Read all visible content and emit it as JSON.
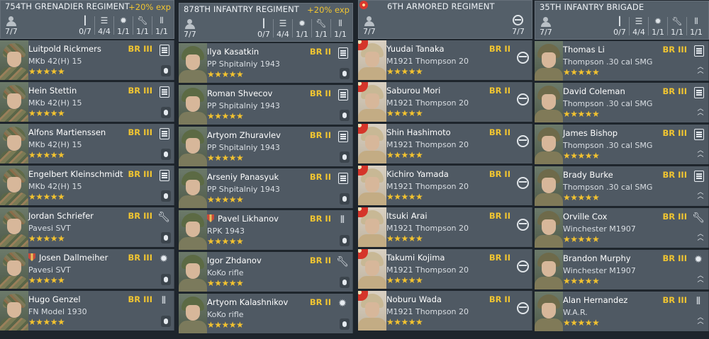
{
  "columns": [
    {
      "title": "754TH GRENADIER REGIMENT",
      "bonus": "+20% exp",
      "squad_count": "7/7",
      "stats": [
        {
          "icon": "rifle-icon",
          "value": "0/7"
        },
        {
          "icon": "assault-icon",
          "value": "4/4"
        },
        {
          "icon": "explosion-icon",
          "value": "1/1"
        },
        {
          "icon": "wrench-icon",
          "value": "1/1"
        },
        {
          "icon": "ammo-icon",
          "value": "1/1"
        }
      ],
      "soldiers": [
        {
          "name": "Luitpold Rickmers",
          "weapon": "MKb 42(H) 15",
          "br": "BR III",
          "stars": "★★★★★",
          "class_icon": "assault-icon",
          "rank_icon": "rank-icon"
        },
        {
          "name": "Hein Stettin",
          "weapon": "MKb 42(H) 15",
          "br": "BR III",
          "stars": "★★★★★",
          "class_icon": "assault-icon",
          "rank_icon": "rank-icon"
        },
        {
          "name": "Alfons Martienssen",
          "weapon": "MKb 42(H) 15",
          "br": "BR III",
          "stars": "★★★★★",
          "class_icon": "assault-icon",
          "rank_icon": "rank-icon"
        },
        {
          "name": "Engelbert Kleinschmidt",
          "weapon": "MKb 42(H) 15",
          "br": "BR III",
          "stars": "★★★★★",
          "class_icon": "assault-icon",
          "rank_icon": "rank-icon"
        },
        {
          "name": "Jordan Schriefer",
          "weapon": "Pavesi SVT",
          "br": "BR III",
          "stars": "★★★★★",
          "class_icon": "wrench-icon",
          "rank_icon": "rank-icon"
        },
        {
          "name": "Josen Dallmeiher",
          "weapon": "Pavesi SVT",
          "br": "BR III",
          "stars": "★★★★★",
          "class_icon": "explosion-icon",
          "rank_icon": "rank-icon",
          "medal": true
        },
        {
          "name": "Hugo Genzel",
          "weapon": "FN Model 1930",
          "br": "BR III",
          "stars": "★★★★★",
          "class_icon": "ammo-icon",
          "rank_icon": "rank-icon"
        }
      ]
    },
    {
      "title": "878TH INFANTRY REGIMENT",
      "bonus": "+20% exp",
      "squad_count": "7/7",
      "stats": [
        {
          "icon": "rifle-icon",
          "value": "0/7"
        },
        {
          "icon": "assault-icon",
          "value": "4/4"
        },
        {
          "icon": "explosion-icon",
          "value": "1/1"
        },
        {
          "icon": "wrench-icon",
          "value": "1/1"
        },
        {
          "icon": "ammo-icon",
          "value": "1/1"
        }
      ],
      "soldiers": [
        {
          "name": "Ilya Kasatkin",
          "weapon": "PP Shpitalniy 1943",
          "br": "BR II",
          "stars": "★★★★★",
          "class_icon": "assault-icon",
          "rank_icon": "rank-icon"
        },
        {
          "name": "Roman Shvecov",
          "weapon": "PP Shpitalniy 1943",
          "br": "BR II",
          "stars": "★★★★★",
          "class_icon": "assault-icon",
          "rank_icon": "rank-icon"
        },
        {
          "name": "Artyom Zhuravlev",
          "weapon": "PP Shpitalniy 1943",
          "br": "BR II",
          "stars": "★★★★★",
          "class_icon": "assault-icon",
          "rank_icon": "rank-icon"
        },
        {
          "name": "Arseniy Panasyuk",
          "weapon": "PP Shpitalniy 1943",
          "br": "BR II",
          "stars": "★★★★★",
          "class_icon": "assault-icon",
          "rank_icon": "rank-icon"
        },
        {
          "name": "Pavel Likhanov",
          "weapon": "RPK 1943",
          "br": "BR II",
          "stars": "★★★★★",
          "class_icon": "ammo-icon",
          "rank_icon": "rank-icon",
          "medal": true
        },
        {
          "name": "Igor Zhdanov",
          "weapon": "KoKo rifle",
          "br": "BR II",
          "stars": "★★★★★",
          "class_icon": "wrench-icon",
          "rank_icon": "rank-icon"
        },
        {
          "name": "Artyom Kalashnikov",
          "weapon": "KoKo rifle",
          "br": "BR II",
          "stars": "★★★★★",
          "class_icon": "explosion-icon",
          "rank_icon": "rank-icon"
        }
      ]
    },
    {
      "title": "6TH ARMORED REGIMENT",
      "squad_count": "7/7",
      "vehicle_count": "7/7",
      "soldiers": [
        {
          "name": "Yuudai Tanaka",
          "weapon": "M1921 Thompson 20",
          "br": "BR II",
          "stars": "★★★★★",
          "class_icon": "steering-wheel-icon"
        },
        {
          "name": "Saburou Mori",
          "weapon": "M1921 Thompson 20",
          "br": "BR II",
          "stars": "★★★★★",
          "class_icon": "steering-wheel-icon"
        },
        {
          "name": "Shin Hashimoto",
          "weapon": "M1921 Thompson 20",
          "br": "BR II",
          "stars": "★★★★★",
          "class_icon": "steering-wheel-icon"
        },
        {
          "name": "Kichiro Yamada",
          "weapon": "M1921 Thompson 20",
          "br": "BR II",
          "stars": "★★★★★",
          "class_icon": "steering-wheel-icon"
        },
        {
          "name": "Itsuki Arai",
          "weapon": "M1921 Thompson 20",
          "br": "BR II",
          "stars": "★★★★★",
          "class_icon": "steering-wheel-icon"
        },
        {
          "name": "Takumi Kojima",
          "weapon": "M1921 Thompson 20",
          "br": "BR II",
          "stars": "★★★★★",
          "class_icon": "steering-wheel-icon"
        },
        {
          "name": "Noburu Wada",
          "weapon": "M1921 Thompson 20",
          "br": "BR II",
          "stars": "★★★★★",
          "class_icon": "steering-wheel-icon"
        }
      ]
    },
    {
      "title": "35TH INFANTRY BRIGADE",
      "squad_count": "7/7",
      "stats": [
        {
          "icon": "rifle-icon",
          "value": "0/7"
        },
        {
          "icon": "assault-icon",
          "value": "4/4"
        },
        {
          "icon": "explosion-icon",
          "value": "1/1"
        },
        {
          "icon": "wrench-icon",
          "value": "1/1"
        },
        {
          "icon": "ammo-icon",
          "value": "1/1"
        }
      ],
      "soldiers": [
        {
          "name": "Thomas Li",
          "weapon": "Thompson .30 cal SMG",
          "br": "BR III",
          "stars": "★★★★★",
          "class_icon": "assault-icon",
          "rank_icon": "chevron-rank-icon"
        },
        {
          "name": "David Coleman",
          "weapon": "Thompson .30 cal SMG",
          "br": "BR III",
          "stars": "★★★★★",
          "class_icon": "assault-icon",
          "rank_icon": "chevron-rank-icon"
        },
        {
          "name": "James Bishop",
          "weapon": "Thompson .30 cal SMG",
          "br": "BR III",
          "stars": "★★★★★",
          "class_icon": "assault-icon",
          "rank_icon": "chevron-rank-icon"
        },
        {
          "name": "Brady Burke",
          "weapon": "Thompson .30 cal SMG",
          "br": "BR III",
          "stars": "★★★★★",
          "class_icon": "assault-icon",
          "rank_icon": "chevron-rank-icon"
        },
        {
          "name": "Orville Cox",
          "weapon": "Winchester M1907",
          "br": "BR III",
          "stars": "★★★★★",
          "class_icon": "wrench-icon",
          "rank_icon": "chevron-rank-icon"
        },
        {
          "name": "Brandon Murphy",
          "weapon": "Winchester M1907",
          "br": "BR III",
          "stars": "★★★★★",
          "class_icon": "explosion-icon",
          "rank_icon": "chevron-rank-icon"
        },
        {
          "name": "Alan Hernandez",
          "weapon": "W.A.R.",
          "br": "BR III",
          "stars": "★★★★★",
          "class_icon": "ammo-icon",
          "rank_icon": "chevron-rank-icon"
        }
      ]
    }
  ],
  "colors": {
    "accent_gold": "#f1c531",
    "panel": "#4f5963",
    "header": "#545f69",
    "background": "#1e252c"
  }
}
